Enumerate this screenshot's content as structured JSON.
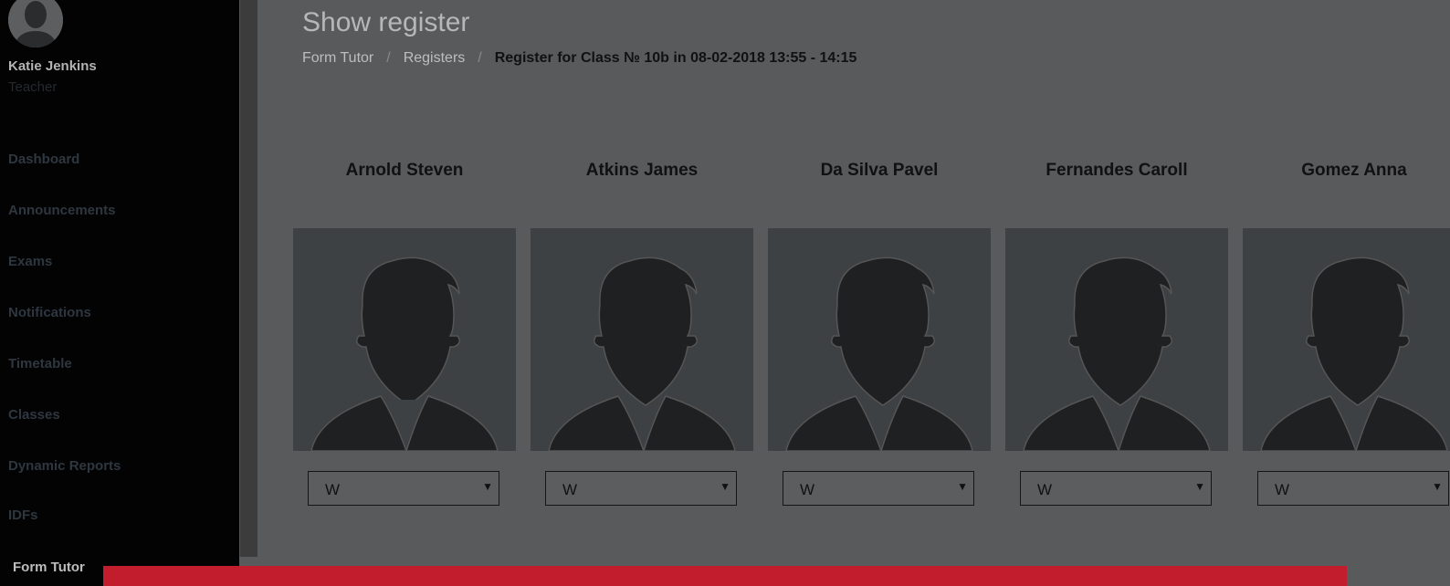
{
  "user": {
    "name": "Katie Jenkins",
    "role": "Teacher"
  },
  "nav": [
    {
      "label": "Dashboard"
    },
    {
      "label": "Announcements"
    },
    {
      "label": "Exams"
    },
    {
      "label": "Notifications"
    },
    {
      "label": "Timetable"
    },
    {
      "label": "Classes"
    },
    {
      "label": "Dynamic Reports"
    },
    {
      "label": "IDFs"
    },
    {
      "label": "Form Tutor"
    }
  ],
  "page": {
    "title": "Show register",
    "breadcrumb": [
      "Form Tutor",
      "Registers",
      "Register for Class № 10b in 08-02-2018 13:55 - 14:15"
    ]
  },
  "students": [
    {
      "name": "Arnold Steven",
      "mark": "W"
    },
    {
      "name": "Atkins James",
      "mark": "W"
    },
    {
      "name": "Da Silva Pavel",
      "mark": "W"
    },
    {
      "name": "Fernandes Caroll",
      "mark": "W"
    },
    {
      "name": "Gomez Anna",
      "mark": "W"
    }
  ],
  "colors": {
    "accent_bar": "#c21d2d",
    "sidebar_bg": "#030303",
    "overlay_bg": "#595a5c"
  }
}
